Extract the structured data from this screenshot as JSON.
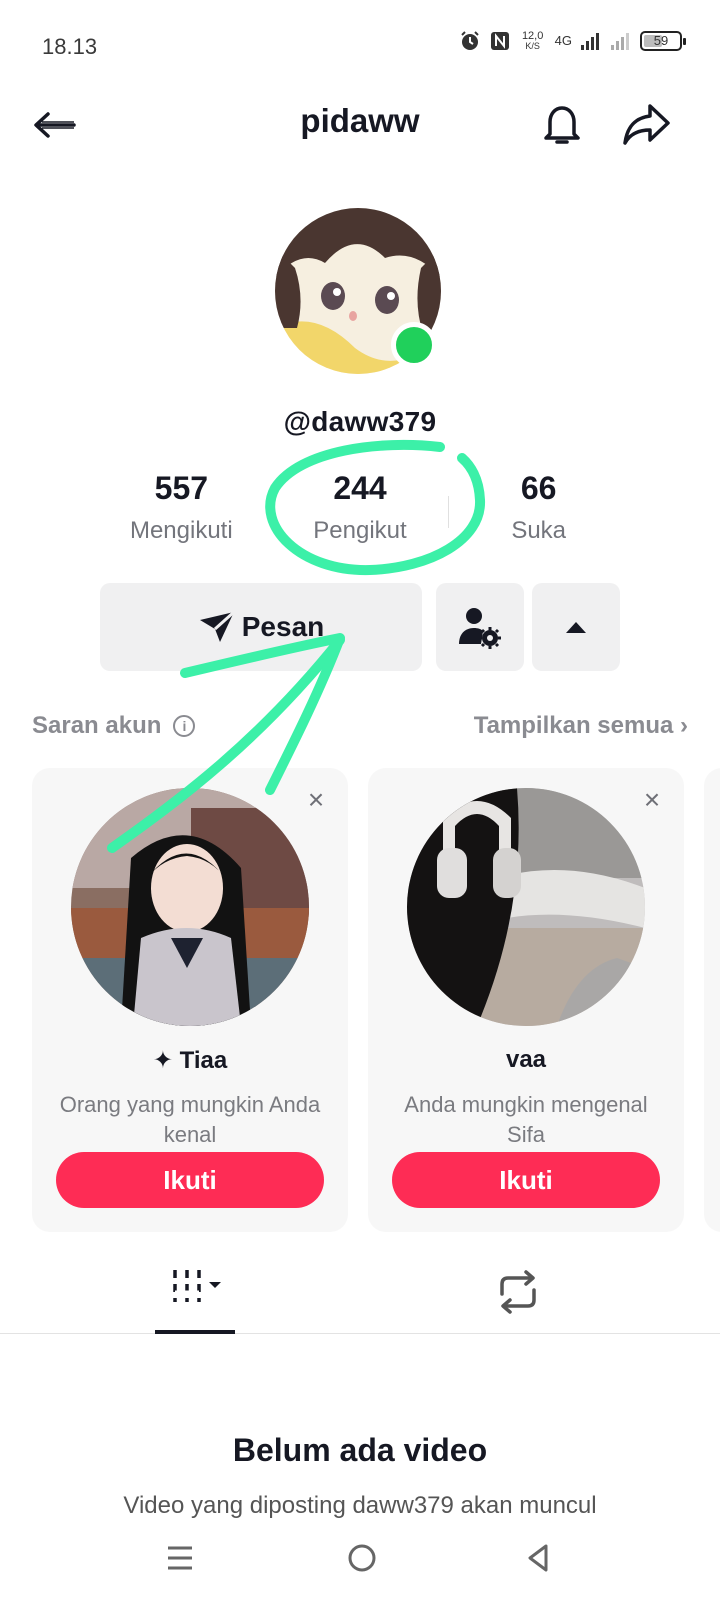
{
  "status_bar": {
    "time": "18.13",
    "net_speed_value": "12,0",
    "net_speed_unit": "K/S",
    "network": "4G",
    "battery": "59",
    "battery_level": 0.59
  },
  "header": {
    "title": "pidaww",
    "icons": [
      "arrow-left-icon",
      "bell-icon",
      "share-icon"
    ]
  },
  "profile": {
    "handle": "@daww379",
    "online_color": "#20d05b",
    "stats": [
      {
        "value": "557",
        "label": "Mengikuti"
      },
      {
        "value": "244",
        "label": "Pengikut"
      },
      {
        "value": "66",
        "label": "Suka"
      }
    ]
  },
  "actions": {
    "message_label": "Pesan",
    "icons": [
      "send-icon",
      "user-settings-icon",
      "caret-up-icon"
    ]
  },
  "suggestions": {
    "title": "Saran akun",
    "show_all": "Tampilkan semua ›",
    "close_symbol": "×",
    "cards": [
      {
        "name": "✦ Tiaa",
        "reason": "Orang yang mungkin Anda kenal",
        "follow": "Ikuti"
      },
      {
        "name": "vaa",
        "reason": "Anda mungkin mengenal Sifa",
        "follow": "Ikuti"
      }
    ]
  },
  "empty_state": {
    "title": "Belum ada video",
    "description": "Video yang diposting daww379 akan muncul"
  },
  "colors": {
    "accent": "#fe2c55",
    "annotation": "#3cf0a8",
    "button_bg": "#f0f0f1"
  }
}
